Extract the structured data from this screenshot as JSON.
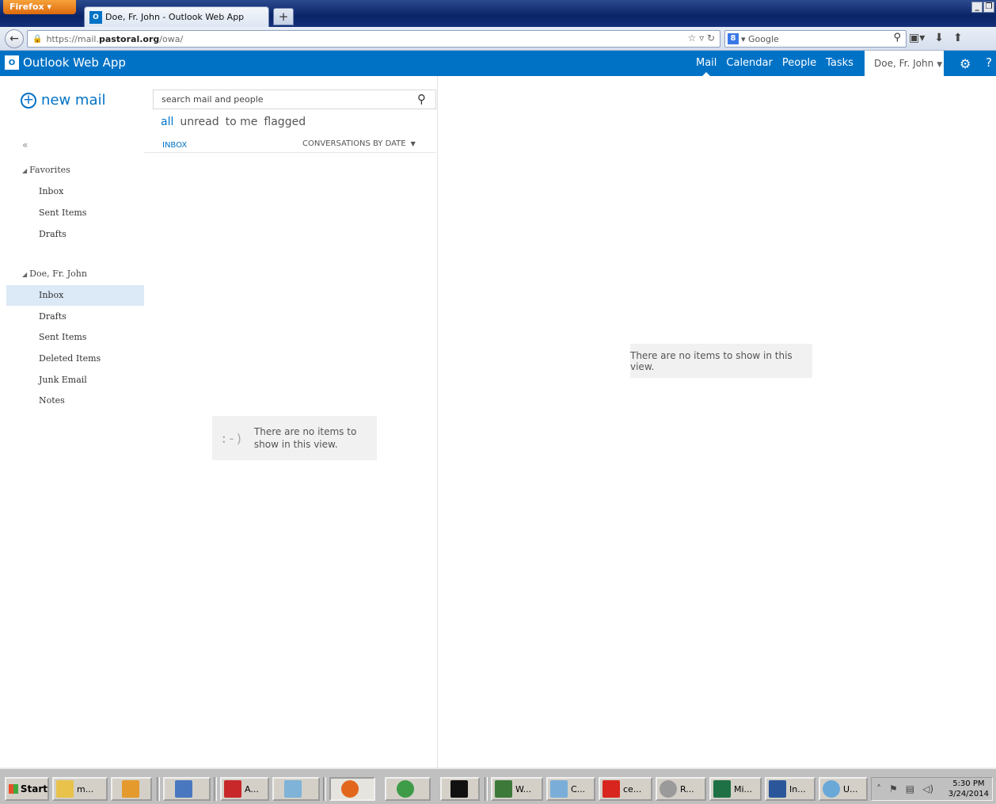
{
  "browser": {
    "menu_button": "Firefox ▾",
    "tab_title": "Doe, Fr. John - Outlook Web App",
    "new_tab": "+",
    "url_prefix": "https://mail.",
    "url_domain": "pastoral.org",
    "url_path": "/owa/",
    "search_engine": "Google",
    "window_controls": [
      "_",
      "❐"
    ]
  },
  "owa": {
    "app_name": "Outlook Web App",
    "nav": [
      {
        "label": "Mail",
        "active": true
      },
      {
        "label": "Calendar",
        "active": false
      },
      {
        "label": "People",
        "active": false
      },
      {
        "label": "Tasks",
        "active": false
      }
    ],
    "user_name": "Doe, Fr. John"
  },
  "left_nav": {
    "new_mail": "new mail",
    "collapse": "«",
    "favorites_header": "Favorites",
    "favorites": [
      "Inbox",
      "Sent Items",
      "Drafts"
    ],
    "account_header": "Doe, Fr. John",
    "folders": [
      "Inbox",
      "Drafts",
      "Sent Items",
      "Deleted Items",
      "Junk Email",
      "Notes"
    ],
    "selected_folder": "Inbox"
  },
  "list": {
    "search_placeholder": "search mail and people",
    "filters": [
      "all",
      "unread",
      "to me",
      "flagged"
    ],
    "active_filter": "all",
    "folder_label": "INBOX",
    "sort_label": "CONVERSATIONS BY DATE",
    "empty_face": ":-)",
    "empty_message": "There are no items to show in this view."
  },
  "reading_pane": {
    "empty_message": "There are no items to show in this view."
  },
  "taskbar": {
    "start": "Start",
    "buttons": [
      "m...",
      "A...",
      "W...",
      "C...",
      "ce...",
      "R...",
      "Mi...",
      "In...",
      "U..."
    ],
    "time": "5:30 PM",
    "date": "3/24/2014"
  }
}
